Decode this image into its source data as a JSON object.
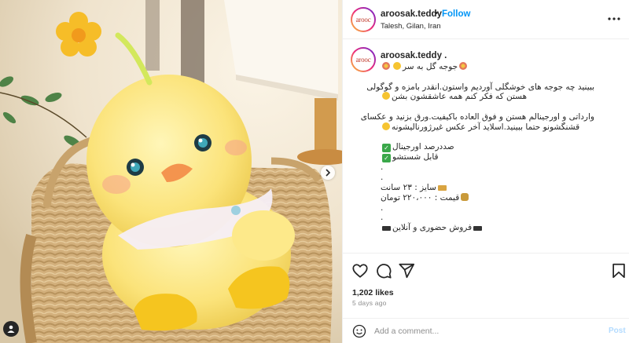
{
  "post": {
    "username": "aroosak.teddy",
    "avatar_text": "arooc",
    "location": "Talesh, Gilan, Iran",
    "separator": "•",
    "follow_label": "Follow",
    "caption_username": "aroosak.teddy .",
    "caption_lines": [
      "جوجه گل به سر",
      "",
      "ببینید چه جوجه های خوشگلی آوردیم واستون.انقدر بامزه و گوگولی",
      "هستن که فکر کنم همه عاشقشون بشن",
      "",
      "وارداتی و اورجینالم هستن و فوق العاده باکیفیت.ورق بزنید و عکسای",
      "قشنگشونو حتما ببینید.اسلاید آخر عکس غیرژورنالیشونه",
      "",
      "صددرصد اورجینال",
      "قابل شستشو",
      ".",
      ".",
      "سایز : ۲۳ سانت",
      "قیمت : ۲۲۰،۰۰۰ تومان",
      ".",
      ".",
      "فروش حضوری و آنلاین"
    ],
    "likes": "1,202 likes",
    "time_ago": "5 days ago",
    "comment_placeholder": "Add a comment...",
    "post_label": "Post"
  },
  "icons": {
    "more": "more-horizontal-icon",
    "like": "heart-icon",
    "comment": "comment-bubble-icon",
    "share": "paper-plane-icon",
    "save": "bookmark-icon",
    "emoji": "smiley-icon",
    "next": "chevron-right-icon",
    "tags": "user-tag-icon"
  },
  "colors": {
    "accent": "#0095f6",
    "post_disabled": "#b3dbff",
    "muted": "#8e8e8e",
    "text": "#262626"
  }
}
